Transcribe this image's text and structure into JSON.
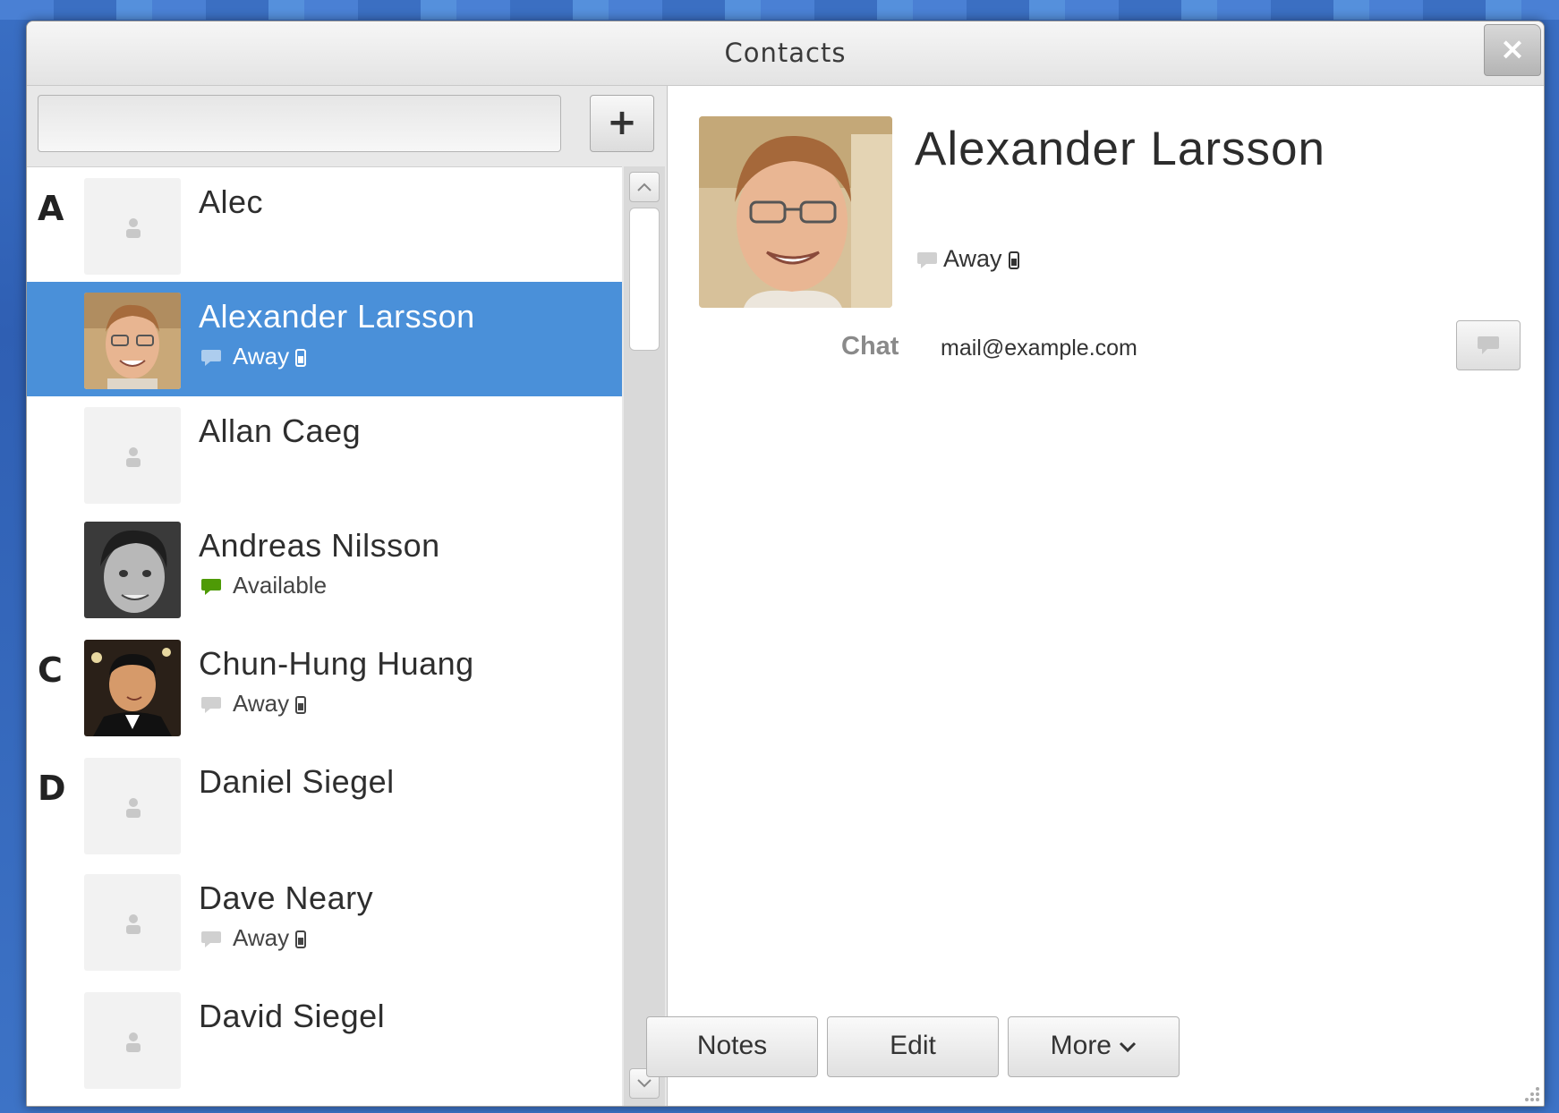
{
  "window": {
    "title": "Contacts",
    "close_label": "×"
  },
  "toolbar": {
    "add_label": "+"
  },
  "search": {
    "value": "",
    "placeholder": ""
  },
  "contacts": [
    {
      "letter": "A",
      "name": "Alec",
      "status": "",
      "photo": false
    },
    {
      "letter": "",
      "name": "Alexander Larsson",
      "status": "Away",
      "photo": true,
      "selected": true
    },
    {
      "letter": "",
      "name": "Allan Caeg",
      "status": "",
      "photo": false
    },
    {
      "letter": "",
      "name": "Andreas Nilsson",
      "status": "Available",
      "photo": true
    },
    {
      "letter": "C",
      "name": "Chun-Hung Huang",
      "status": "Away",
      "photo": true
    },
    {
      "letter": "D",
      "name": "Daniel Siegel",
      "status": "",
      "photo": false
    },
    {
      "letter": "",
      "name": "Dave Neary",
      "status": "Away",
      "photo": false
    },
    {
      "letter": "",
      "name": "David Siegel",
      "status": "",
      "photo": false
    }
  ],
  "detail": {
    "name": "Alexander Larsson",
    "status": "Away",
    "chat_label": "Chat",
    "chat_value": "mail@example.com"
  },
  "actions": {
    "notes": "Notes",
    "edit": "Edit",
    "more": "More"
  },
  "colors": {
    "selection": "#4a90d9",
    "available": "#4e9a06",
    "away": "#d0d0d0"
  }
}
